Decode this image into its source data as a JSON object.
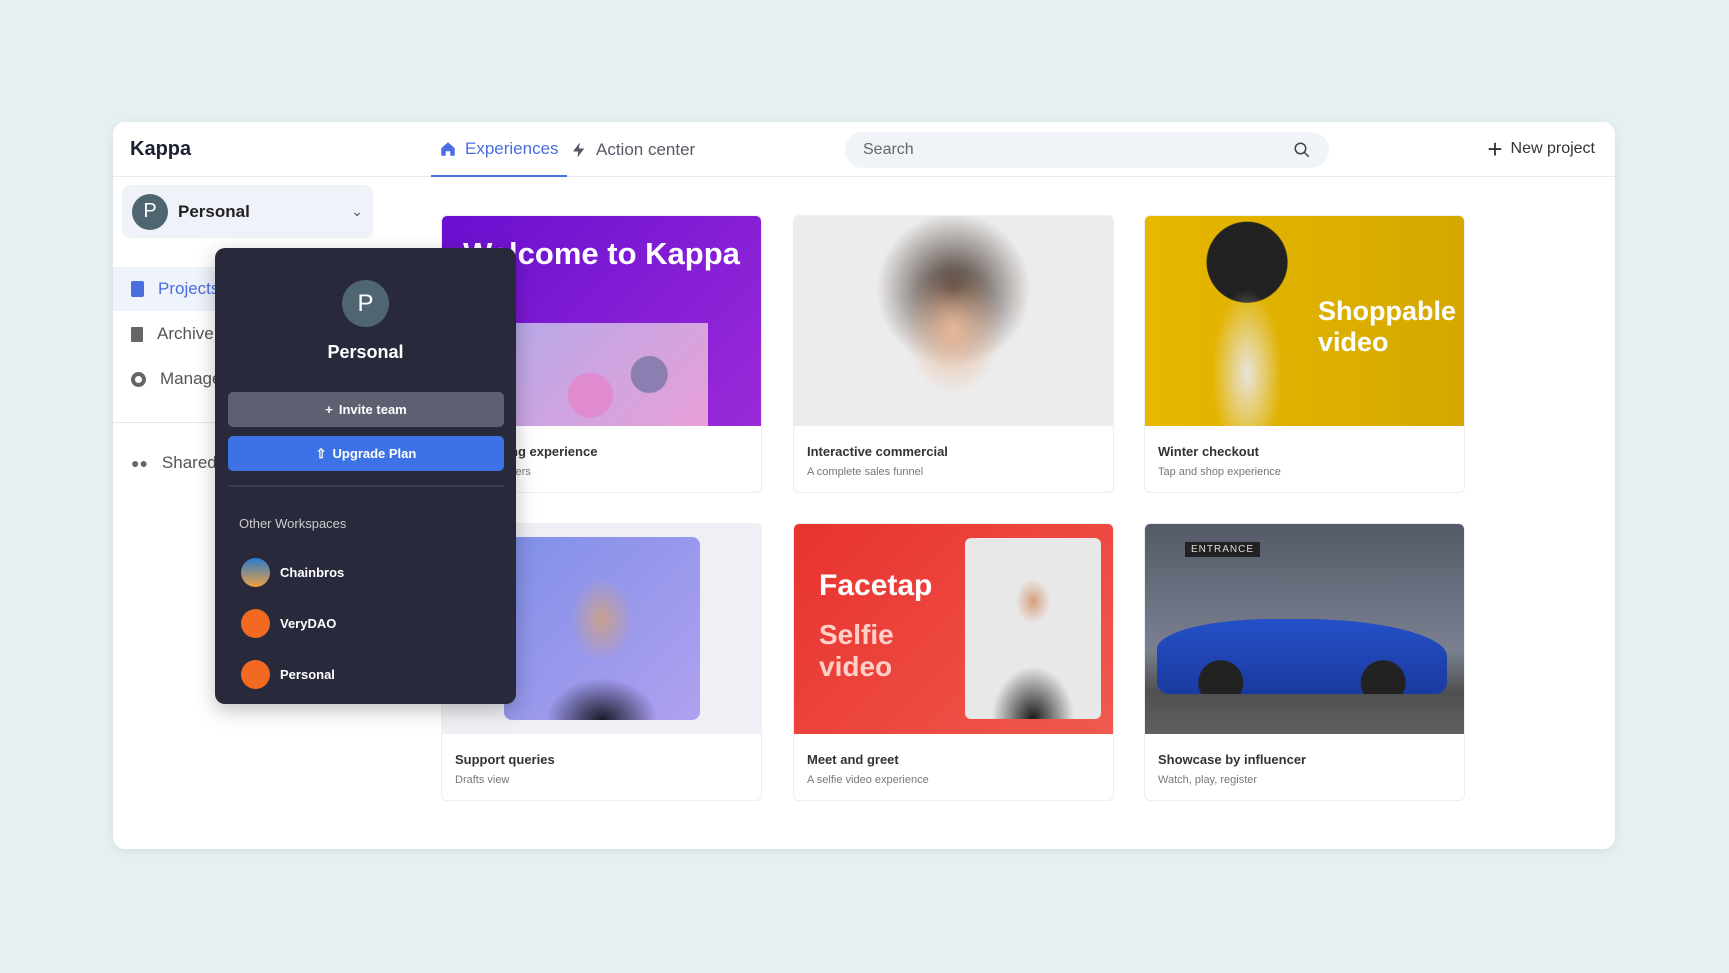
{
  "app": {
    "title": "Kappa"
  },
  "tabs": [
    {
      "label": "Experiences",
      "icon": "home-icon",
      "active": true
    },
    {
      "label": "Action center",
      "icon": "lightning-icon",
      "active": false
    }
  ],
  "search": {
    "placeholder": "Search"
  },
  "new_project": {
    "label": "New project"
  },
  "workspace": {
    "initial": "P",
    "name": "Personal"
  },
  "sidebar": {
    "items": [
      {
        "label": "Projects",
        "icon": "document-icon",
        "active": true
      },
      {
        "label": "Archive",
        "icon": "trash-icon"
      },
      {
        "label": "Manage",
        "icon": "gear-icon"
      },
      {
        "label": "Shared",
        "icon": "users-icon"
      }
    ]
  },
  "cards": [
    {
      "title": "ng experience",
      "subtitle": "sers",
      "banner": "Welcome to Kappa"
    },
    {
      "title": "Interactive commercial",
      "subtitle": "A complete sales funnel"
    },
    {
      "title": "Winter checkout",
      "subtitle": "Tap and shop experience",
      "banner": "Shoppable video"
    },
    {
      "title": "Support queries",
      "subtitle": "Drafts view"
    },
    {
      "title": "Meet and greet",
      "subtitle": "A selfie video experience",
      "banner": "Facetap",
      "banner2": "Selfie video"
    },
    {
      "title": "Showcase by influencer",
      "subtitle": "Watch, play, register",
      "sign": "ENTRANCE"
    }
  ],
  "dropdown": {
    "initial": "P",
    "name": "Personal",
    "invite": "Invite team",
    "upgrade": "Upgrade Plan",
    "other_label": "Other Workspaces",
    "workspaces": [
      {
        "name": "Chainbros"
      },
      {
        "name": "VeryDAO"
      },
      {
        "name": "Personal"
      }
    ]
  },
  "colors": {
    "accent": "#4a6ee0",
    "upgrade": "#3d72e6",
    "dropdown_bg": "#282a3c"
  }
}
